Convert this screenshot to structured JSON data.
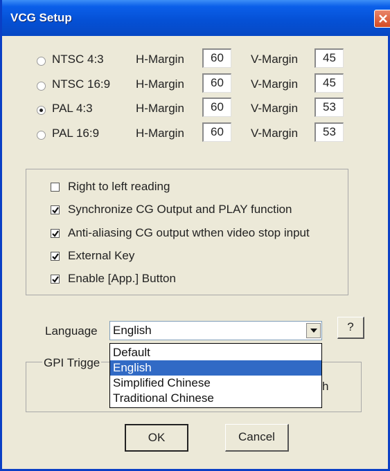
{
  "window": {
    "title": "VCG Setup"
  },
  "video_modes": [
    {
      "label": "NTSC 4:3",
      "checked": false,
      "h_label": "H-Margin",
      "h_value": "60",
      "v_label": "V-Margin",
      "v_value": "45"
    },
    {
      "label": "NTSC 16:9",
      "checked": false,
      "h_label": "H-Margin",
      "h_value": "60",
      "v_label": "V-Margin",
      "v_value": "45"
    },
    {
      "label": "PAL 4:3",
      "checked": true,
      "h_label": "H-Margin",
      "h_value": "60",
      "v_label": "V-Margin",
      "v_value": "53"
    },
    {
      "label": "PAL 16:9",
      "checked": false,
      "h_label": "H-Margin",
      "h_value": "60",
      "v_label": "V-Margin",
      "v_value": "53"
    }
  ],
  "options": [
    {
      "label": "Right to left reading",
      "checked": false
    },
    {
      "label": "Synchronize CG Output and PLAY function",
      "checked": true
    },
    {
      "label": "Anti-aliasing CG output wthen video stop input",
      "checked": true
    },
    {
      "label": "External Key",
      "checked": true
    },
    {
      "label": "Enable [App.] Button",
      "checked": true
    }
  ],
  "language": {
    "label": "Language",
    "selected": "English",
    "help_label": "?",
    "dropdown_options": [
      "Default",
      "English",
      "Simplified Chinese",
      "Traditional Chinese"
    ],
    "highlighted_index": 1
  },
  "gpi": {
    "group_label": "GPI Trigge",
    "partial_text": "h"
  },
  "buttons": {
    "ok": "OK",
    "cancel": "Cancel"
  }
}
